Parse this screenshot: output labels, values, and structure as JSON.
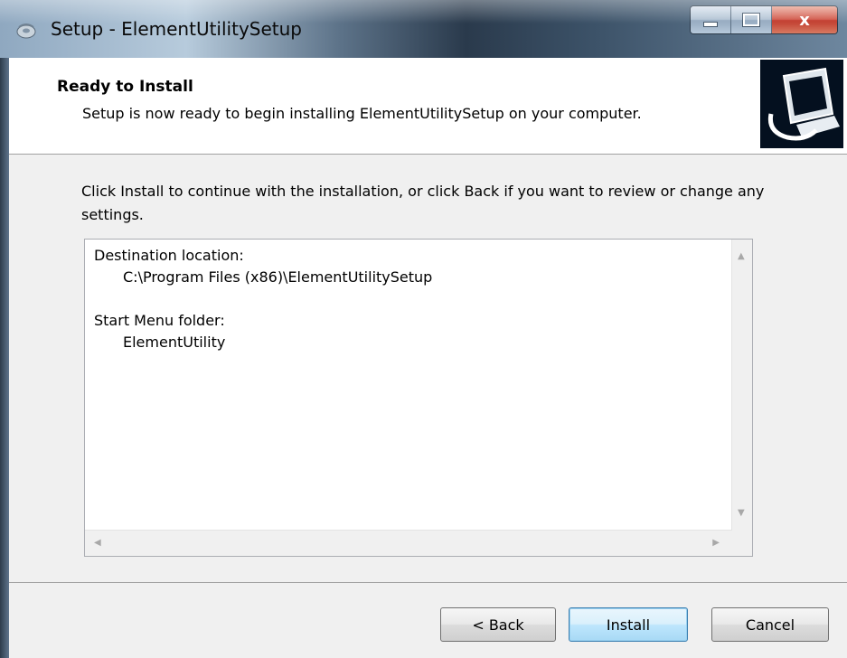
{
  "window": {
    "title": "Setup - ElementUtilitySetup",
    "icon": "setup-disc-icon",
    "caption_buttons": {
      "minimize": "minimize-icon",
      "maximize": "maximize-icon",
      "close": "x"
    }
  },
  "header": {
    "title": "Ready to Install",
    "subtitle": "Setup is now ready to begin installing ElementUtilitySetup on your computer.",
    "image": "computer-install-icon"
  },
  "body": {
    "instruction": "Click Install to continue with the installation, or click Back if you want to review or change any settings.",
    "memo": {
      "dest_label": "Destination location:",
      "dest_value": "C:\\Program Files (x86)\\ElementUtilitySetup",
      "menu_label": "Start Menu folder:",
      "menu_value": "ElementUtility"
    }
  },
  "footer": {
    "back": "< Back",
    "install": "Install",
    "cancel": "Cancel"
  },
  "colors": {
    "header_bg": "#ffffff",
    "body_bg": "#f0f0f0",
    "close_button": "#c0392b",
    "default_button_border": "#3c7fb1"
  }
}
